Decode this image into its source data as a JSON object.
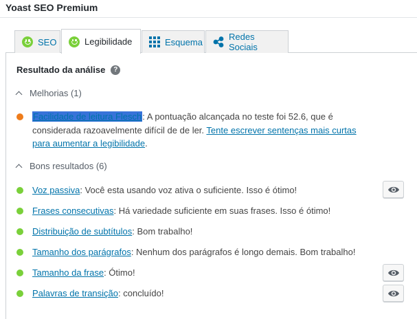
{
  "app": {
    "title": "Yoast SEO Premium"
  },
  "tabs": [
    {
      "label": "SEO",
      "icon": "smiley-icon"
    },
    {
      "label": "Legibilidade",
      "icon": "smiley-icon"
    },
    {
      "label": "Esquema",
      "icon": "grid-icon"
    },
    {
      "label": "Redes Sociais",
      "icon": "share-icon"
    }
  ],
  "analysis": {
    "title": "Resultado da análise",
    "help_symbol": "?",
    "improvements": {
      "heading": "Melhorias (1)",
      "items": [
        {
          "link": "Facilidade de leitura Flesch",
          "text": ": A pontuação alcançada no teste foi 52.6, que é considerada razoavelmente difícil de de ler. ",
          "link2": "Tente escrever sentenças mais curtas para aumentar a legibilidade",
          "tail": "."
        }
      ]
    },
    "good": {
      "heading": "Bons resultados (6)",
      "items": [
        {
          "link": "Voz passiva",
          "text": ": Você esta usando voz ativa o suficiente. Isso é ótimo!"
        },
        {
          "link": "Frases consecutivas",
          "text": ": Há variedade suficiente em suas frases. Isso é ótimo!"
        },
        {
          "link": "Distribuição de subtítulos",
          "text": ": Bom trabalho!"
        },
        {
          "link": "Tamanho dos parágrafos",
          "text": ": Nenhum dos parágrafos é longo demais. Bom trabalho!"
        },
        {
          "link": "Tamanho da frase",
          "text": ": Ótimo!"
        },
        {
          "link": "Palavras de transição",
          "text": ": concluído!"
        }
      ]
    }
  },
  "colors": {
    "good": "#7ad03a",
    "ok": "#ee7c1b",
    "link": "#0073aa",
    "highlight": "#3873d9"
  }
}
